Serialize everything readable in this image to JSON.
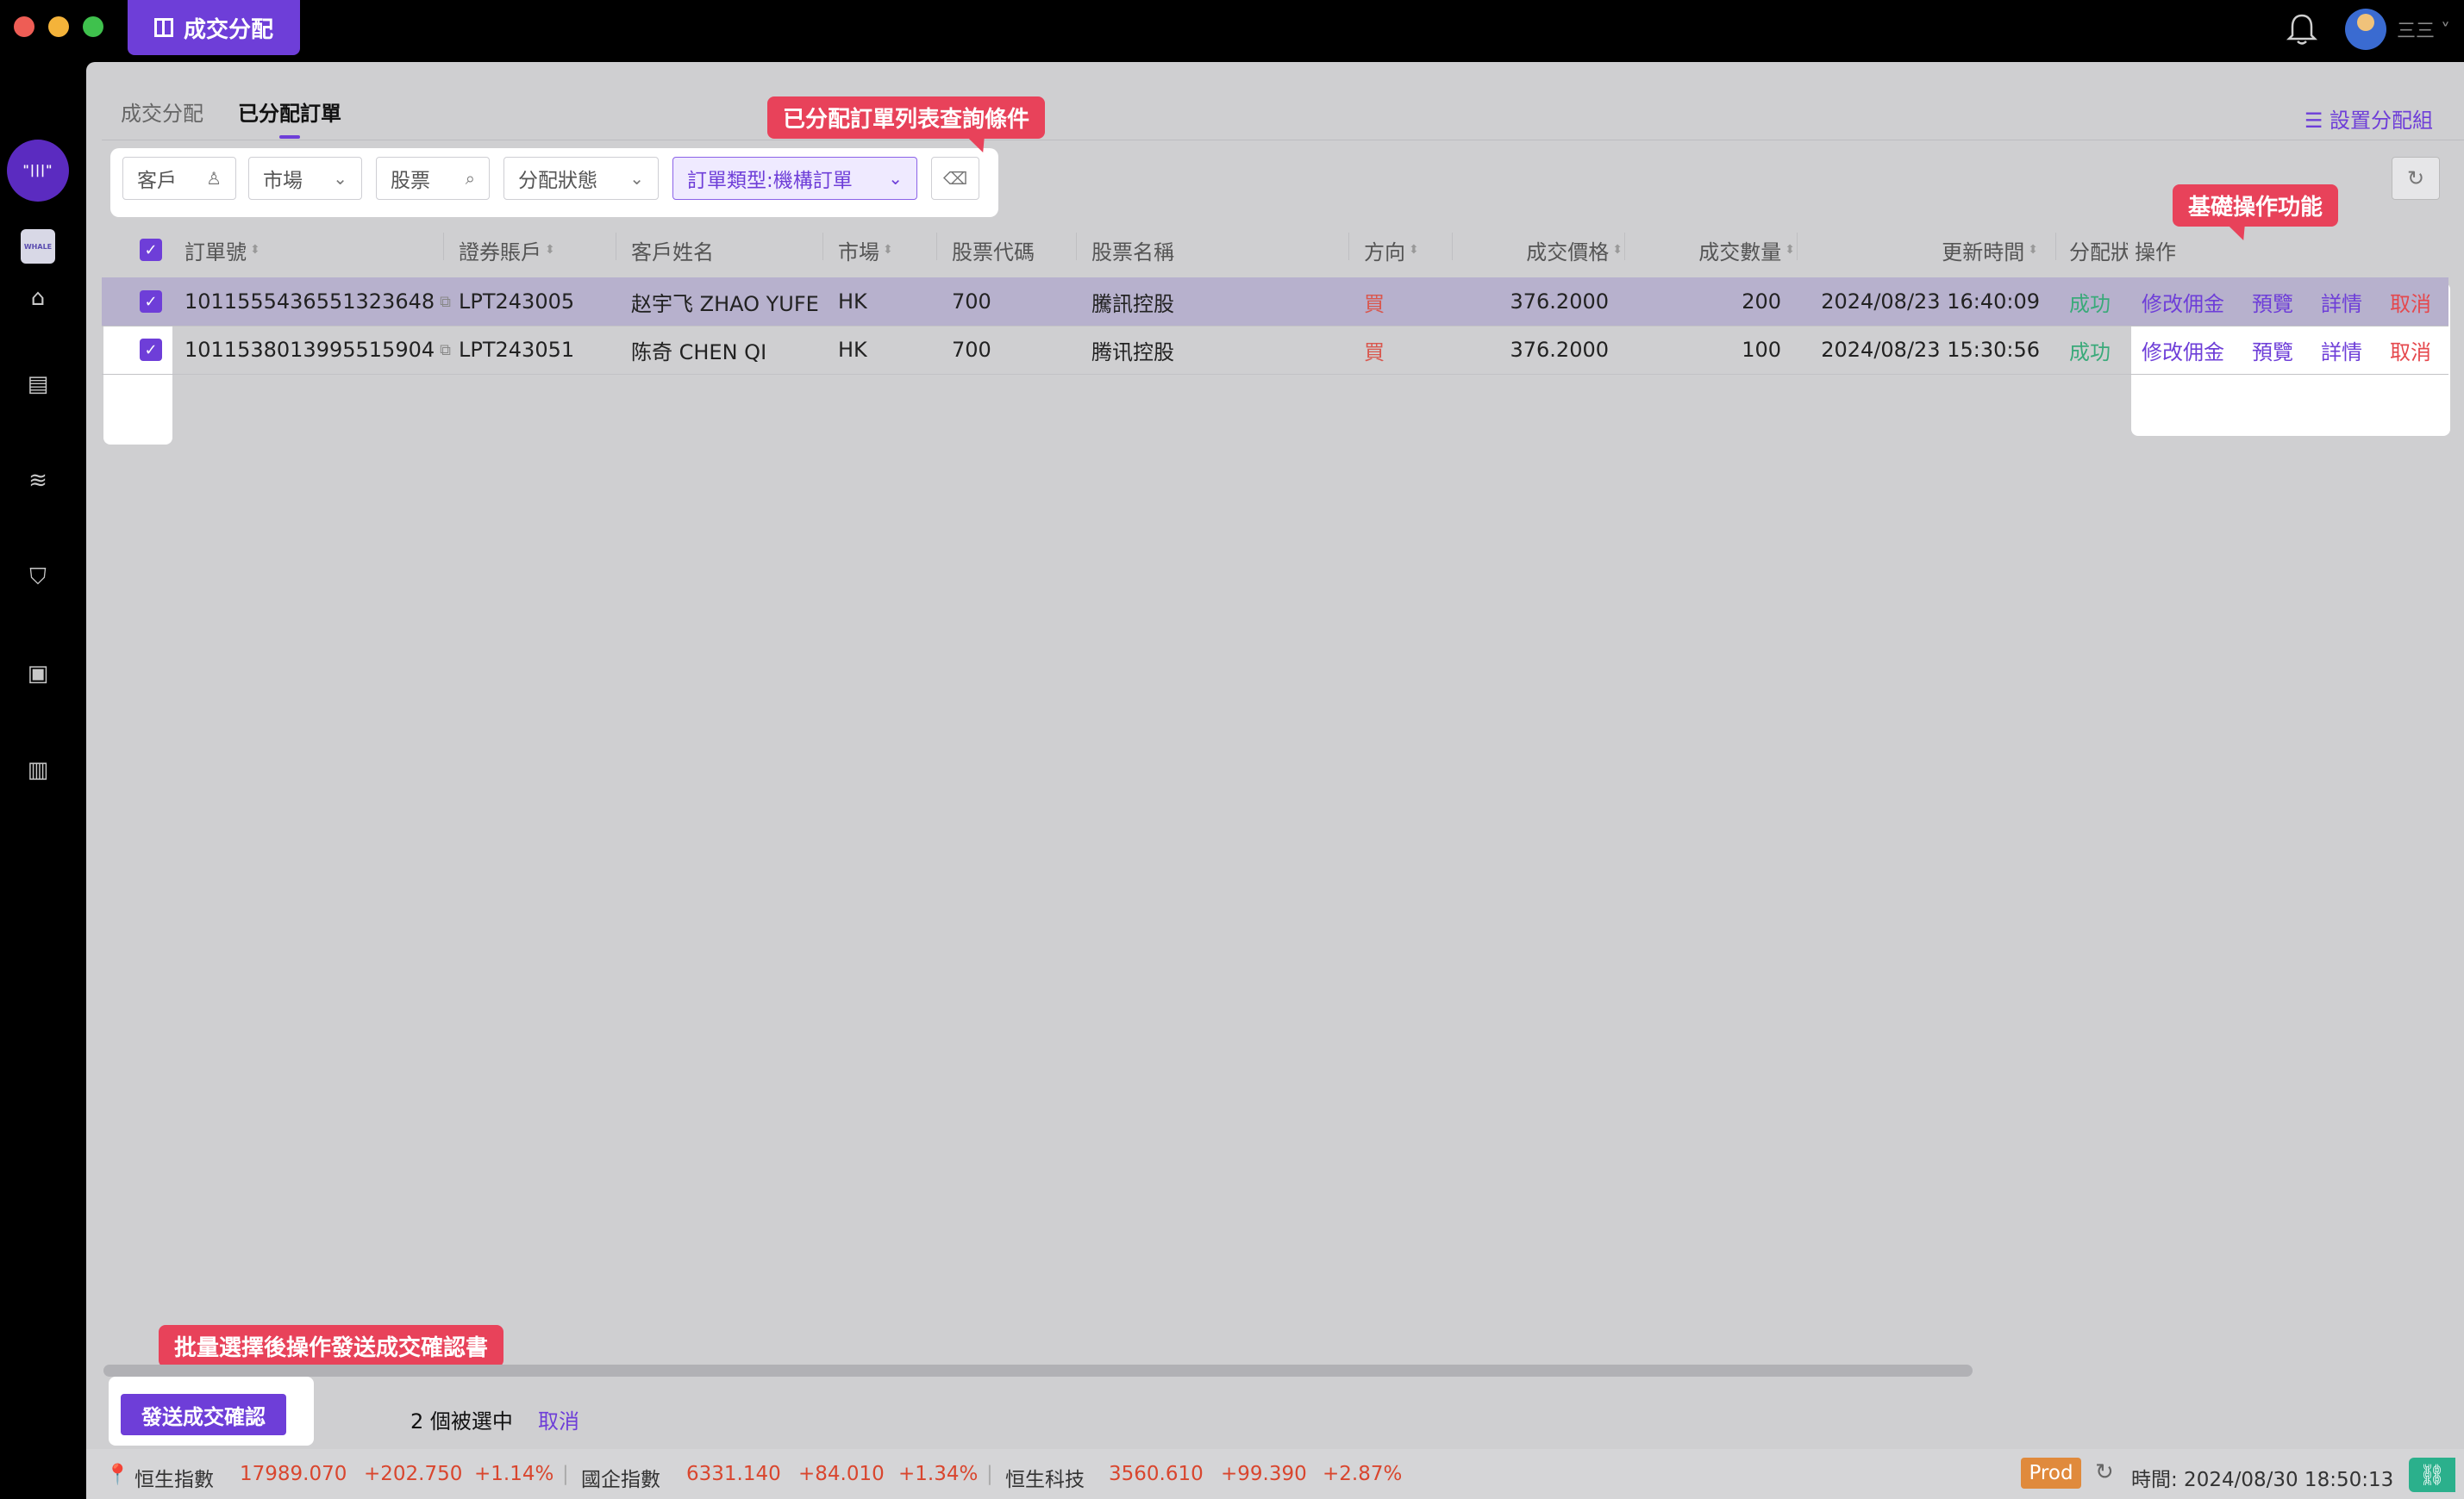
{
  "app": {
    "tab_title": "成交分配",
    "user_name": "三三"
  },
  "tabs": [
    {
      "label": "成交分配"
    },
    {
      "label": "已分配訂單"
    }
  ],
  "setup_group_label": "設置分配組",
  "filters": {
    "client": "客戶",
    "market": "市場",
    "stock": "股票",
    "alloc_status": "分配狀態",
    "order_type": "訂單類型:機構訂單"
  },
  "callouts": {
    "query": "已分配訂單列表查詢條件",
    "ops": "基礎操作功能",
    "batch": "批量選擇後操作發送成交確認書"
  },
  "table": {
    "columns": [
      "訂單號",
      "證券賬戶",
      "客戶姓名",
      "市場",
      "股票代碼",
      "股票名稱",
      "方向",
      "成交價格",
      "成交數量",
      "更新時間",
      "分配狀",
      "操作"
    ],
    "rows": [
      {
        "order_no": "1011555436551323648",
        "account": "LPT243005",
        "client_name": "赵宇飞 ZHAO YUFEI",
        "market": "HK",
        "code": "700",
        "stock_name": "騰訊控股",
        "side": "買",
        "price": "376.2000",
        "qty": "200",
        "updated": "2024/08/23 16:40:09",
        "status": "成功"
      },
      {
        "order_no": "1011538013995515904",
        "account": "LPT243051",
        "client_name": "陈奇 CHEN QI",
        "market": "HK",
        "code": "700",
        "stock_name": "腾讯控股",
        "side": "買",
        "price": "376.2000",
        "qty": "100",
        "updated": "2024/08/23 15:30:56",
        "status": "成功"
      }
    ],
    "actions": {
      "edit_commission": "修改佣金",
      "preview": "預覽",
      "detail": "詳情",
      "cancel": "取消"
    }
  },
  "batch_bar": {
    "send_label": "發送成交確認",
    "selected_text": "2 個被選中",
    "cancel_label": "取消"
  },
  "ticker": [
    {
      "name": "恒生指數",
      "value": "17989.070",
      "change": "+202.750",
      "pct": "+1.14%"
    },
    {
      "name": "國企指數",
      "value": "6331.140",
      "change": "+84.010",
      "pct": "+1.34%"
    },
    {
      "name": "恒生科技",
      "value": "3560.610",
      "change": "+99.390",
      "pct": "+2.87%"
    }
  ],
  "status": {
    "env": "Prod",
    "time": "時間: 2024/08/30 18:50:13"
  },
  "colors": {
    "accent": "#6e3ed8",
    "callout": "#e8425a",
    "buy": "#d9574e",
    "success": "#3aaa7a"
  }
}
